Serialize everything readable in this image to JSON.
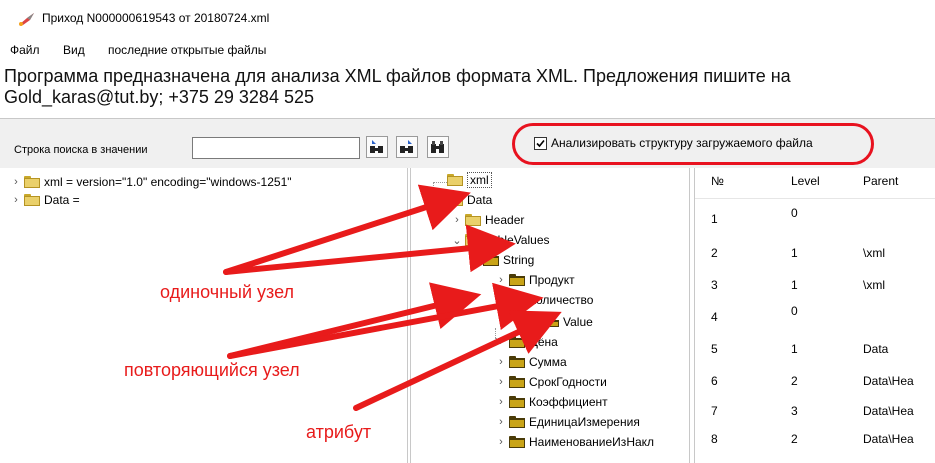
{
  "window": {
    "title": "Приход N000000619543 от 20180724.xml",
    "icon": "rocket-icon"
  },
  "menu": [
    "Файл",
    "Вид",
    "последние открытые файлы"
  ],
  "info_line1": "Программа предназначена для анализа XML файлов формата XML. Предложения пишите на",
  "info_line2": "Gold_karas@tut.by; +375 29 3284 525",
  "toolbar": {
    "search_label": "Строка поиска в значении",
    "search_value": "",
    "buttons": [
      "find-previous-icon",
      "find-next-icon",
      "binoculars-icon"
    ],
    "analyze_checkbox_label": "Анализировать структуру загружаемого файла",
    "analyze_checked": true
  },
  "left_tree": [
    "xml = version=\"1.0\" encoding=\"windows-1251\"",
    "Data ="
  ],
  "mid_tree": [
    "xml",
    "Data",
    "Header",
    "TableValues",
    "String",
    "Продукт",
    "Количество",
    "Value",
    "Цена",
    "Сумма",
    "СрокГодности",
    "Коэффициент",
    "ЕдиницаИзмерения",
    "НаименованиеИзНакл"
  ],
  "grid": {
    "columns": [
      "№",
      "Level",
      "Parent"
    ],
    "rows": [
      [
        "1",
        "0",
        ""
      ],
      [
        "2",
        "1",
        "\\xml"
      ],
      [
        "3",
        "1",
        "\\xml"
      ],
      [
        "4",
        "0",
        ""
      ],
      [
        "5",
        "1",
        "Data"
      ],
      [
        "6",
        "2",
        "Data\\Hea"
      ],
      [
        "7",
        "3",
        "Data\\Hea"
      ],
      [
        "8",
        "2",
        "Data\\Hea"
      ]
    ]
  },
  "annotations": {
    "single_node": "одиночный узел",
    "repeating_node": "повторяющийся узел",
    "attribute": "атрибут"
  },
  "colors": {
    "annotation": "#e81b1b",
    "folder": "#ead06a",
    "folder_repeating": "#c9a417"
  }
}
